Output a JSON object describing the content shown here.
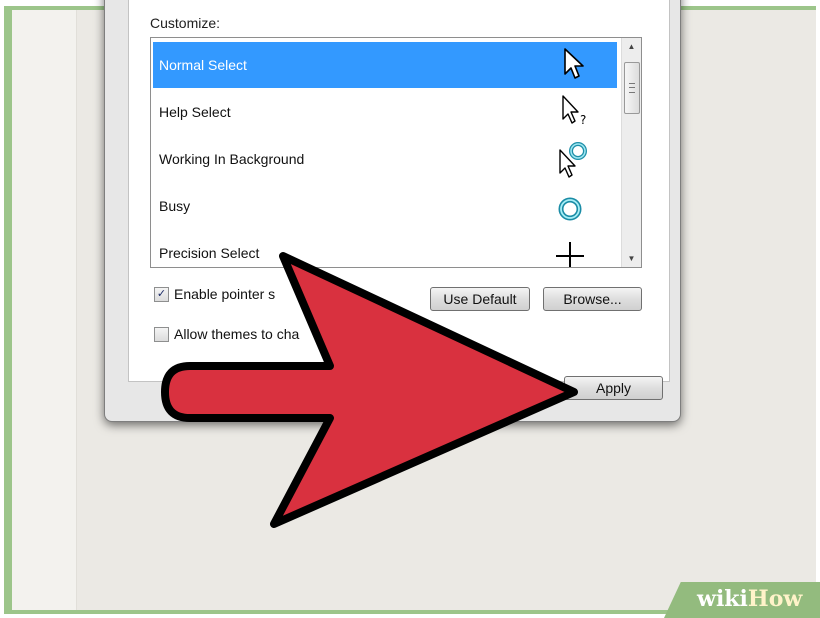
{
  "dialog": {
    "customize_label": "Customize:",
    "cursor_list": [
      {
        "label": "Normal Select",
        "icon": "arrow-pointer-icon",
        "selected": true
      },
      {
        "label": "Help Select",
        "icon": "help-pointer-icon",
        "selected": false
      },
      {
        "label": "Working In Background",
        "icon": "working-background-pointer-icon",
        "selected": false
      },
      {
        "label": "Busy",
        "icon": "busy-ring-icon",
        "selected": false
      },
      {
        "label": "Precision Select",
        "icon": "crosshair-icon",
        "selected": false
      }
    ],
    "enable_shadow": {
      "label": "Enable pointer s",
      "checked": true
    },
    "allow_themes": {
      "label": "Allow themes to cha",
      "checked": false
    },
    "use_default_label": "Use Default",
    "browse_label": "Browse...",
    "apply_label": "Apply"
  },
  "overlay": {
    "arrow_color": "#d9313f",
    "arrow_outline": "#000000"
  },
  "watermark": {
    "part1": "wiki",
    "part2": "How",
    "badge_color": "#93bb7e"
  },
  "colors": {
    "selection": "#3399ff",
    "frame": "#9cc58a",
    "screen_bg": "#ebe9e4"
  }
}
